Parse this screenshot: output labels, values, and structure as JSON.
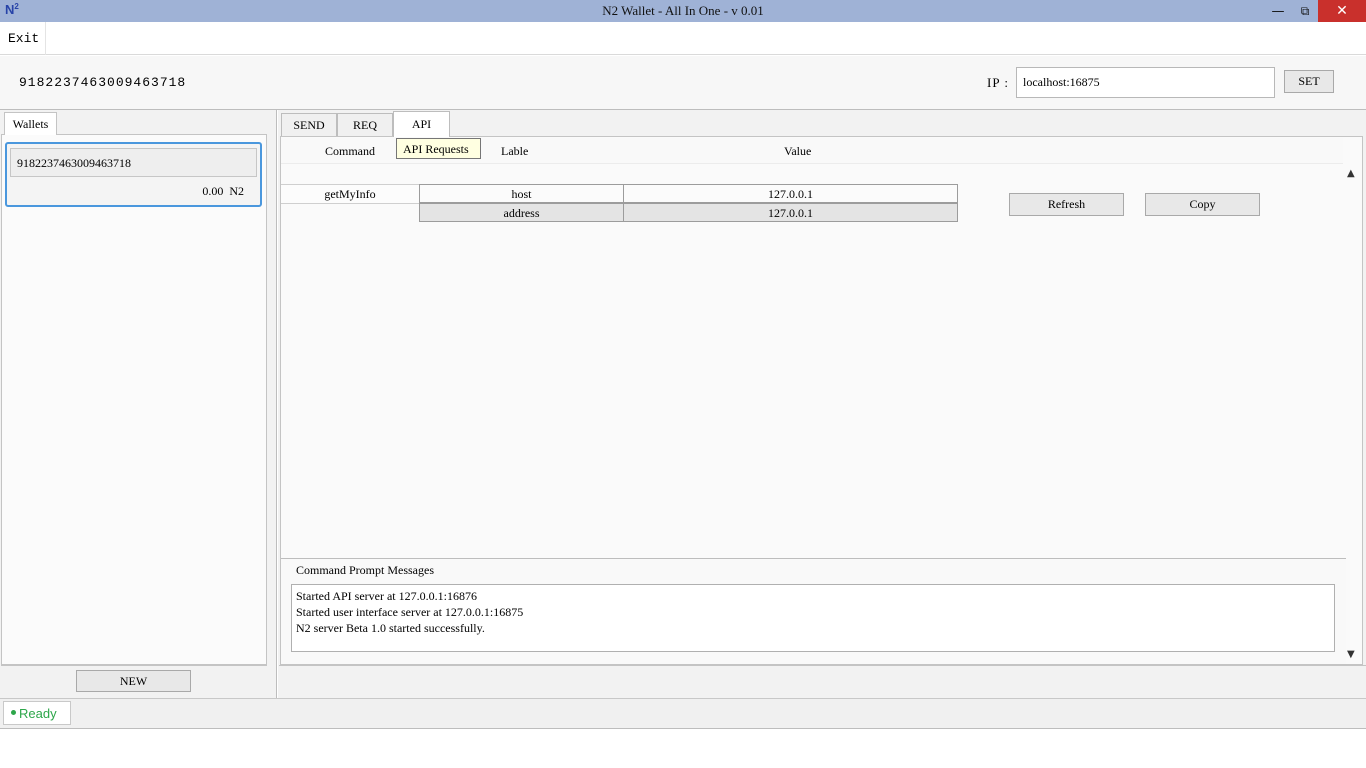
{
  "window": {
    "logo": "N",
    "logo_sup": "2",
    "title": "N2 Wallet - All In One - v 0.01",
    "minimize_icon": "minimize-icon",
    "maximize_icon": "restore-icon",
    "close_icon": "close-icon"
  },
  "menu": {
    "exit_label": "Exit"
  },
  "header": {
    "address": "9182237463009463718",
    "ip_label": "IP :",
    "ip_value": "localhost:16875",
    "set_label": "SET"
  },
  "wallets": {
    "tab_label": "Wallets",
    "items": [
      {
        "address": "9182237463009463718",
        "balance": "0.00  N2"
      }
    ],
    "new_label": "NEW"
  },
  "tabs": [
    {
      "label": "SEND"
    },
    {
      "label": "REQ"
    },
    {
      "label": "API"
    }
  ],
  "api": {
    "tooltip": "API Requests",
    "columns": {
      "command": "Command",
      "lable": "Lable",
      "value": "Value"
    },
    "rows": [
      {
        "command": "getMyInfo",
        "fields": [
          {
            "label": "host",
            "value": "127.0.0.1"
          },
          {
            "label": "address",
            "value": "127.0.0.1"
          }
        ]
      }
    ],
    "refresh_label": "Refresh",
    "copy_label": "Copy"
  },
  "messages": {
    "title": "Command Prompt Messages",
    "lines": [
      "Started API server at 127.0.0.1:16876",
      "Started user interface server at 127.0.0.1:16875",
      "N2 server Beta 1.0 started successfully."
    ]
  },
  "status": {
    "text": "Ready",
    "color": "#2da64a"
  },
  "colors": {
    "titlebar": "#9fb2d6",
    "close": "#c9302c",
    "selection": "#4a97dd",
    "tooltip": "#ffffe1"
  }
}
